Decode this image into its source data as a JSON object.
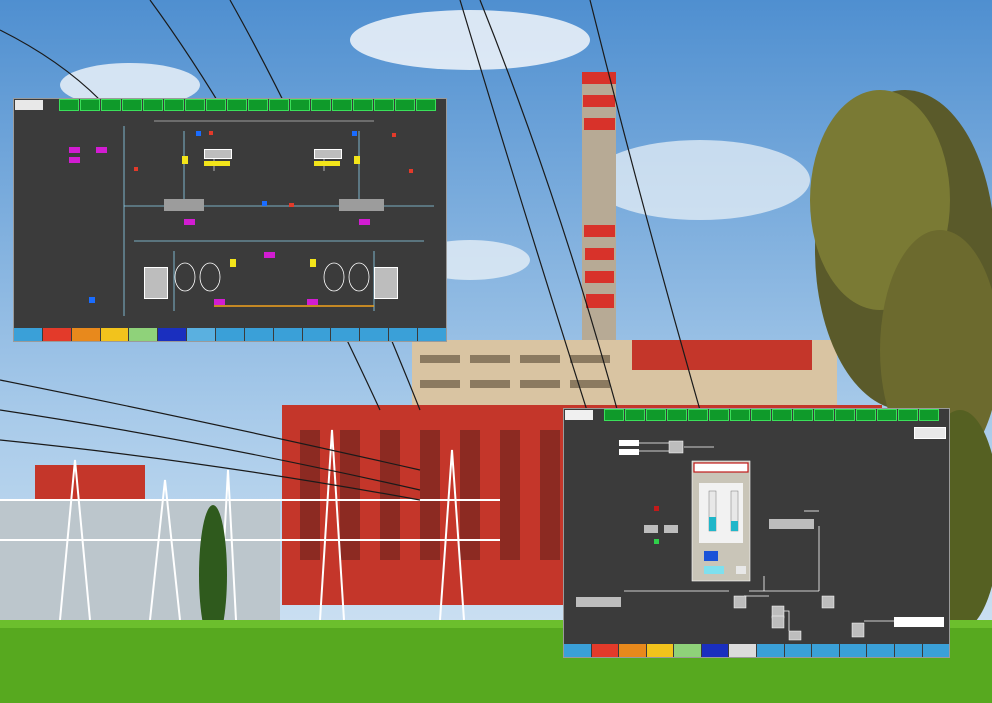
{
  "scada_left": {
    "nav_items": [
      {
        "label": "",
        "color": "#3aa0d8"
      },
      {
        "label": "",
        "color": "#e33a2a"
      },
      {
        "label": "",
        "color": "#e8891c"
      },
      {
        "label": "",
        "color": "#f2c31c"
      },
      {
        "label": "",
        "color": "#8fd27a"
      },
      {
        "label": "",
        "color": "#1a2fbf"
      },
      {
        "label": "",
        "color": "#5ab0e0"
      },
      {
        "label": "",
        "color": "#3aa0d8"
      },
      {
        "label": "",
        "color": "#3aa0d8"
      },
      {
        "label": "",
        "color": "#3aa0d8"
      },
      {
        "label": "",
        "color": "#3aa0d8"
      },
      {
        "label": "",
        "color": "#3aa0d8"
      },
      {
        "label": "",
        "color": "#3aa0d8"
      },
      {
        "label": "",
        "color": "#3aa0d8"
      },
      {
        "label": "",
        "color": "#3aa0d8"
      }
    ]
  },
  "scada_right": {
    "title": "",
    "nav_items": [
      {
        "label": "",
        "color": "#3aa0d8"
      },
      {
        "label": "",
        "color": "#e33a2a"
      },
      {
        "label": "",
        "color": "#e8891c"
      },
      {
        "label": "",
        "color": "#f2c31c"
      },
      {
        "label": "",
        "color": "#8fd27a"
      },
      {
        "label": "",
        "color": "#1a2fbf"
      },
      {
        "label": "",
        "color": "#dcdcdc"
      },
      {
        "label": "",
        "color": "#3aa0d8"
      },
      {
        "label": "",
        "color": "#3aa0d8"
      },
      {
        "label": "",
        "color": "#3aa0d8"
      },
      {
        "label": "",
        "color": "#3aa0d8"
      },
      {
        "label": "",
        "color": "#3aa0d8"
      },
      {
        "label": "",
        "color": "#3aa0d8"
      },
      {
        "label": "",
        "color": "#3aa0d8"
      }
    ]
  },
  "colors": {
    "sky": "#7fb0e0",
    "grass": "#57a91f",
    "building_red": "#c4362a",
    "chimney_red": "#d8322a",
    "panel_bg": "#3b3b3b"
  }
}
